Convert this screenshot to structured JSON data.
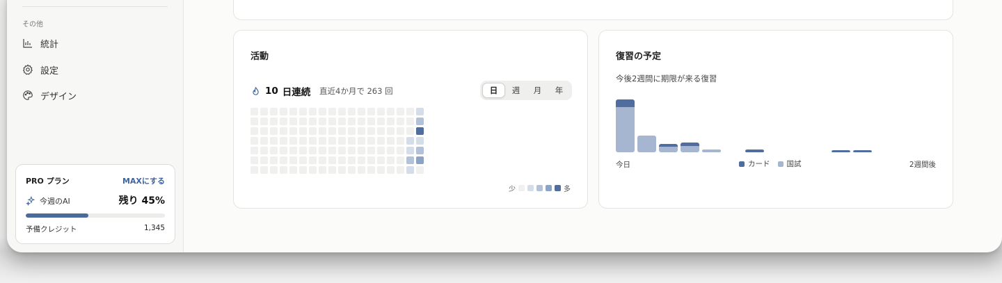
{
  "sidebar": {
    "section_label": "その他",
    "items": [
      {
        "label": "統計",
        "icon": "bar-chart-icon"
      },
      {
        "label": "設定",
        "icon": "gear-icon"
      },
      {
        "label": "デザイン",
        "icon": "palette-icon"
      }
    ]
  },
  "pro": {
    "plan_label": "PRO プラン",
    "upgrade_label": "MAXにする",
    "ai_label": "今週のAI",
    "remaining_label": "残り 45%",
    "ai_remaining_fraction": 0.45,
    "credit_label": "予備クレジット",
    "credit_value": "1,345"
  },
  "activity": {
    "title": "活動",
    "streak_value": "10",
    "streak_unit": "日連続",
    "recent_summary": "直近4か月で 263 回",
    "range_tabs": [
      "日",
      "週",
      "月",
      "年"
    ],
    "active_tab": "日",
    "legend_less": "少",
    "legend_more": "多",
    "colors": [
      "#f0f0ef",
      "#d5dde9",
      "#b3c2d9",
      "#8ea3c4",
      "#4f6e9f"
    ],
    "heatmap_levels": [
      [
        0,
        0,
        0,
        0,
        0,
        0,
        0
      ],
      [
        0,
        0,
        0,
        0,
        0,
        0,
        0
      ],
      [
        0,
        0,
        0,
        0,
        0,
        0,
        0
      ],
      [
        0,
        0,
        0,
        0,
        0,
        0,
        0
      ],
      [
        0,
        0,
        0,
        0,
        0,
        0,
        0
      ],
      [
        0,
        0,
        0,
        0,
        0,
        0,
        0
      ],
      [
        0,
        0,
        0,
        0,
        0,
        0,
        0
      ],
      [
        0,
        0,
        0,
        0,
        0,
        0,
        0
      ],
      [
        0,
        0,
        0,
        0,
        0,
        0,
        0
      ],
      [
        0,
        0,
        0,
        0,
        0,
        0,
        0
      ],
      [
        0,
        0,
        0,
        0,
        0,
        0,
        0
      ],
      [
        0,
        0,
        0,
        0,
        0,
        0,
        0
      ],
      [
        0,
        0,
        0,
        0,
        0,
        0,
        0
      ],
      [
        0,
        0,
        0,
        0,
        0,
        0,
        0
      ],
      [
        0,
        0,
        0,
        0,
        0,
        0,
        0
      ],
      [
        0,
        0,
        0,
        0,
        0,
        0,
        0
      ],
      [
        0,
        0,
        0,
        1,
        1,
        2,
        1
      ],
      [
        1,
        2,
        4,
        1,
        2,
        3,
        0
      ]
    ]
  },
  "review": {
    "title": "復習の予定",
    "subtitle": "今後2週間に期限が来る復習",
    "start_label": "今日",
    "end_label": "2週間後",
    "card_color": "#4f6e9f",
    "exam_color": "#a6b6d1",
    "chart_data": {
      "type": "bar",
      "series": [
        {
          "name": "カード",
          "values": [
            1,
            0,
            0.4,
            0.4,
            0,
            0,
            0.6,
            0,
            0,
            0,
            0.4,
            0.4,
            0,
            0
          ]
        },
        {
          "name": "国試",
          "values": [
            10,
            3.5,
            1.4,
            1.6,
            0.6,
            0,
            0,
            0,
            0,
            0,
            0,
            0,
            0,
            0
          ]
        }
      ],
      "ylim": [
        0,
        11
      ]
    }
  }
}
